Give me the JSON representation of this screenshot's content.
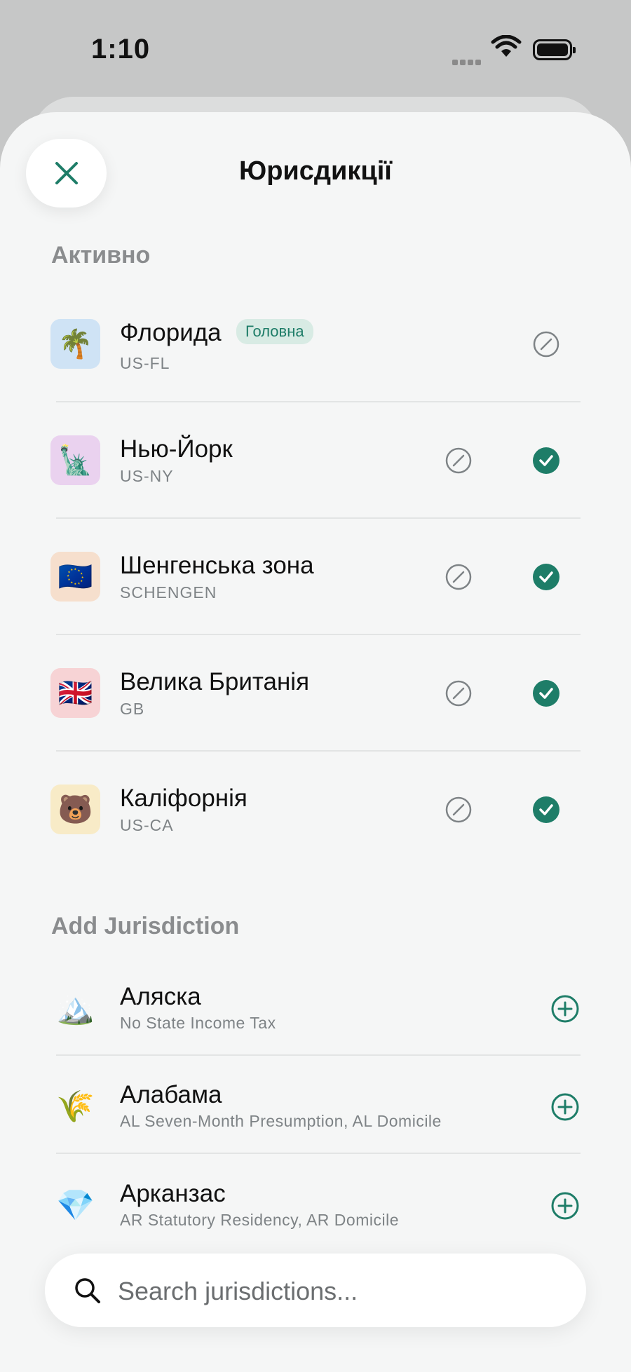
{
  "status_bar": {
    "time": "1:10"
  },
  "header": {
    "title": "Юрисдикції"
  },
  "active": {
    "section_title": "Активно",
    "items": [
      {
        "emoji": "🌴",
        "name": "Флорида",
        "code": "US-FL",
        "badge": "Головна",
        "tile_color": "#cfe3f5",
        "checked": false
      },
      {
        "emoji": "🗽",
        "name": "Нью-Йорк",
        "code": "US-NY",
        "tile_color": "#ead2ef",
        "checked": true
      },
      {
        "emoji": "🇪🇺",
        "name": "Шенгенська зона",
        "code": "SCHENGEN",
        "tile_color": "#f6dfcd",
        "checked": true
      },
      {
        "emoji": "🇬🇧",
        "name": "Велика Британія",
        "code": "GB",
        "tile_color": "#f7d3d5",
        "checked": true
      },
      {
        "emoji": "🐻",
        "name": "Каліфорнія",
        "code": "US-CA",
        "tile_color": "#f8ebc7",
        "checked": true
      }
    ]
  },
  "add": {
    "section_title": "Add Jurisdiction",
    "items": [
      {
        "emoji": "🏔️",
        "name": "Аляска",
        "code": "No State Income Tax"
      },
      {
        "emoji": "🌾",
        "name": "Алабама",
        "code": "AL Seven-Month Presumption, AL Domicile"
      },
      {
        "emoji": "💎",
        "name": "Арканзас",
        "code": "AR Statutory Residency, AR Domicile"
      }
    ]
  },
  "search": {
    "placeholder": "Search jurisdictions..."
  },
  "colors": {
    "accent": "#1e7d68",
    "muted": "#8a8c8e"
  },
  "icons": {
    "close": "close-icon",
    "edit": "edit-icon",
    "check": "check-circle-icon",
    "add": "plus-circle-icon",
    "search": "search-icon"
  }
}
